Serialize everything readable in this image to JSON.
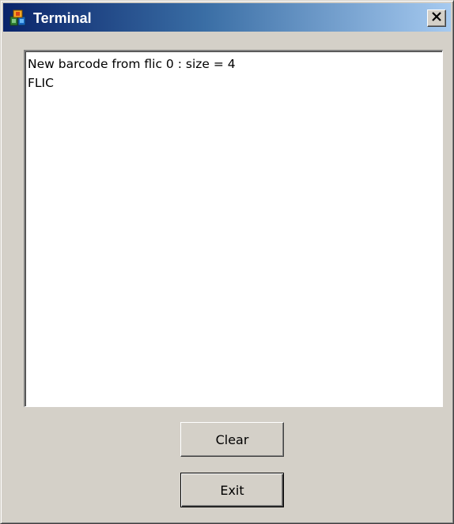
{
  "window": {
    "title": "Terminal",
    "icon": "app-icon",
    "close_icon": "close-icon"
  },
  "terminal": {
    "lines": [
      "New barcode from flic 0 : size = 4",
      "FLIC"
    ]
  },
  "buttons": {
    "clear_label": "Clear",
    "exit_label": "Exit"
  },
  "colors": {
    "titlebar_start": "#0a246a",
    "titlebar_end": "#a6caf0",
    "face": "#d4d0c8"
  }
}
